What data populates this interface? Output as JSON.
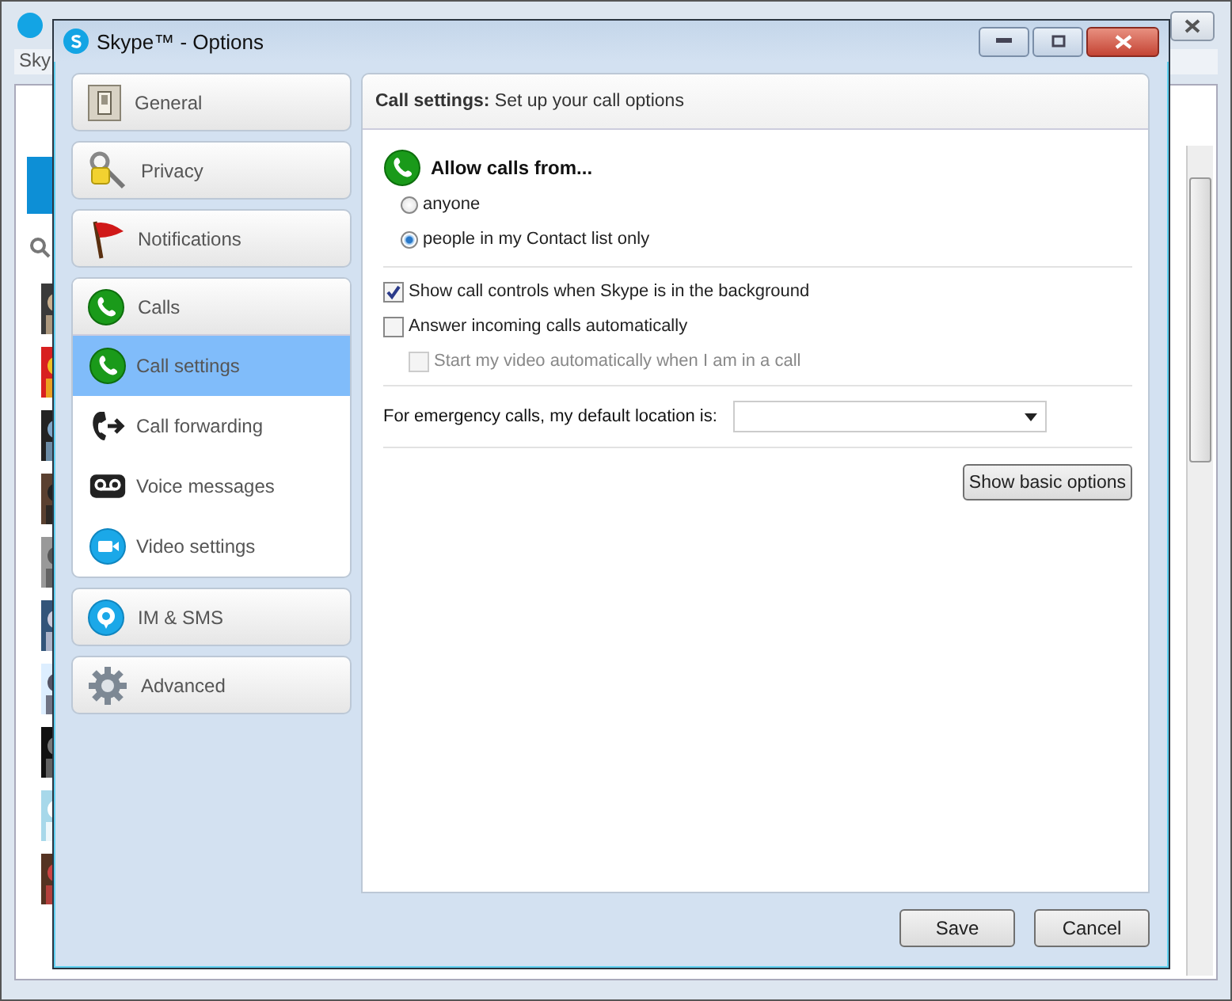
{
  "background_window": {
    "menu": "Sky"
  },
  "window": {
    "title": "Skype™ - Options"
  },
  "nav": [
    {
      "label": "General",
      "selected": false,
      "expanded": false
    },
    {
      "label": "Privacy",
      "selected": false,
      "expanded": false
    },
    {
      "label": "Notifications",
      "selected": false,
      "expanded": false
    },
    {
      "label": "Calls",
      "selected": false,
      "expanded": true,
      "children": [
        {
          "label": "Call settings",
          "selected": true
        },
        {
          "label": "Call forwarding",
          "selected": false
        },
        {
          "label": "Voice messages",
          "selected": false
        },
        {
          "label": "Video settings",
          "selected": false
        }
      ]
    },
    {
      "label": "IM & SMS",
      "selected": false,
      "expanded": false
    },
    {
      "label": "Advanced",
      "selected": false,
      "expanded": false
    }
  ],
  "panel": {
    "header": "**Call settings:** Set up your call options",
    "allow_calls": {
      "title": "Allow calls from...",
      "options": [
        {
          "label": "anyone",
          "selected": false
        },
        {
          "label": "people in my Contact list only",
          "selected": true
        }
      ]
    },
    "checkboxes": [
      {
        "label": "Show call controls when Skype is in the background",
        "checked": true,
        "disabled": false,
        "indent": false
      },
      {
        "label": "Answer incoming calls automatically",
        "checked": false,
        "disabled": false,
        "indent": false
      },
      {
        "label": "Start my video automatically when I am in a call",
        "checked": false,
        "disabled": true,
        "indent": true
      }
    ],
    "emergency": {
      "label": "For emergency calls, my default location is:"
    },
    "button": "Show basic options"
  },
  "footer": [
    "Save",
    "Cancel"
  ]
}
